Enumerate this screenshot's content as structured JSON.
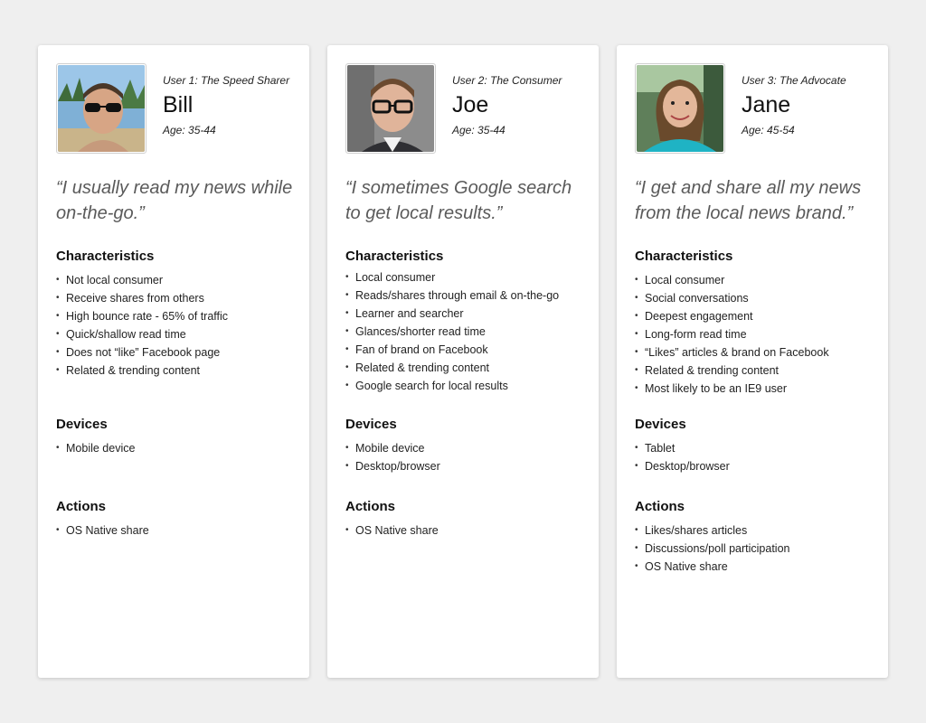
{
  "personas": [
    {
      "role": "User 1: The Speed Sharer",
      "name": "Bill",
      "age": "Age: 35-44",
      "quote": "“I usually read my news while on-the-go.”",
      "characteristics_title": "Characteristics",
      "characteristics": [
        "Not local consumer",
        "Receive shares from others",
        "High bounce rate - 65% of traffic",
        "Quick/shallow read time",
        "Does not “like” Facebook page",
        "Related & trending content"
      ],
      "devices_title": "Devices",
      "devices": [
        "Mobile device"
      ],
      "actions_title": "Actions",
      "actions": [
        "OS Native share"
      ]
    },
    {
      "role": "User 2: The Consumer",
      "name": "Joe",
      "age": "Age: 35-44",
      "quote": "“I sometimes Google search to get local results.”",
      "characteristics_title": "Characteristics",
      "characteristics": [
        "Local consumer",
        "Reads/shares through email & on-the-go",
        "Learner and searcher",
        "Glances/shorter read time",
        "Fan of brand on Facebook",
        "Related & trending content",
        "Google search for local results"
      ],
      "devices_title": "Devices",
      "devices": [
        "Mobile device",
        "Desktop/browser"
      ],
      "actions_title": "Actions",
      "actions": [
        "OS Native share"
      ]
    },
    {
      "role": "User 3: The Advocate",
      "name": "Jane",
      "age": "Age: 45-54",
      "quote": "“I get and share all my news from the local news brand.”",
      "characteristics_title": "Characteristics",
      "characteristics": [
        "Local consumer",
        "Social conversations",
        "Deepest engagement",
        "Long-form read time",
        "“Likes” articles & brand on Facebook",
        "Related & trending content",
        "Most likely to be an IE9 user"
      ],
      "devices_title": "Devices",
      "devices": [
        "Tablet",
        "Desktop/browser"
      ],
      "actions_title": "Actions",
      "actions": [
        "Likes/shares articles",
        "Discussions/poll participation",
        "OS Native share"
      ]
    }
  ]
}
